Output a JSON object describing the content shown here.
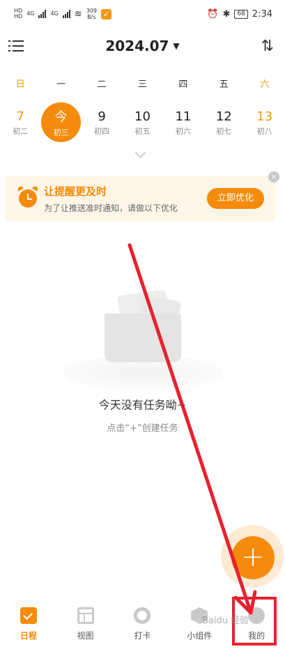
{
  "status_bar": {
    "signal_label_1": "HD",
    "signal_label_2": "HD",
    "net_type_1": "4G",
    "net_type_2": "4G",
    "speed_value": "309",
    "speed_unit": "B/s",
    "app_badge": "✓",
    "battery": "68",
    "time": "2:34"
  },
  "header": {
    "month": "2024.07"
  },
  "week": {
    "weekdays": [
      "日",
      "一",
      "二",
      "三",
      "四",
      "五",
      "六"
    ],
    "dates": [
      {
        "num": "7",
        "lunar": "初二"
      },
      {
        "num": "今",
        "lunar": "初三"
      },
      {
        "num": "9",
        "lunar": "初四"
      },
      {
        "num": "10",
        "lunar": "初五"
      },
      {
        "num": "11",
        "lunar": "初六"
      },
      {
        "num": "12",
        "lunar": "初七"
      },
      {
        "num": "13",
        "lunar": "初八"
      }
    ]
  },
  "banner": {
    "title": "让提醒更及时",
    "subtitle": "为了让推送准时通知，请做以下优化",
    "button": "立即优化",
    "close": "×"
  },
  "empty": {
    "title": "今天没有任务呦~",
    "hint": "点击“+”创建任务"
  },
  "fab": {
    "label": "+"
  },
  "tabs": [
    {
      "label": "日程"
    },
    {
      "label": "视图"
    },
    {
      "label": "打卡"
    },
    {
      "label": "小组件"
    },
    {
      "label": "我的"
    }
  ],
  "colors": {
    "accent": "#f58b0c",
    "annotation": "#e8202e"
  },
  "watermark": "Baidu 经验"
}
